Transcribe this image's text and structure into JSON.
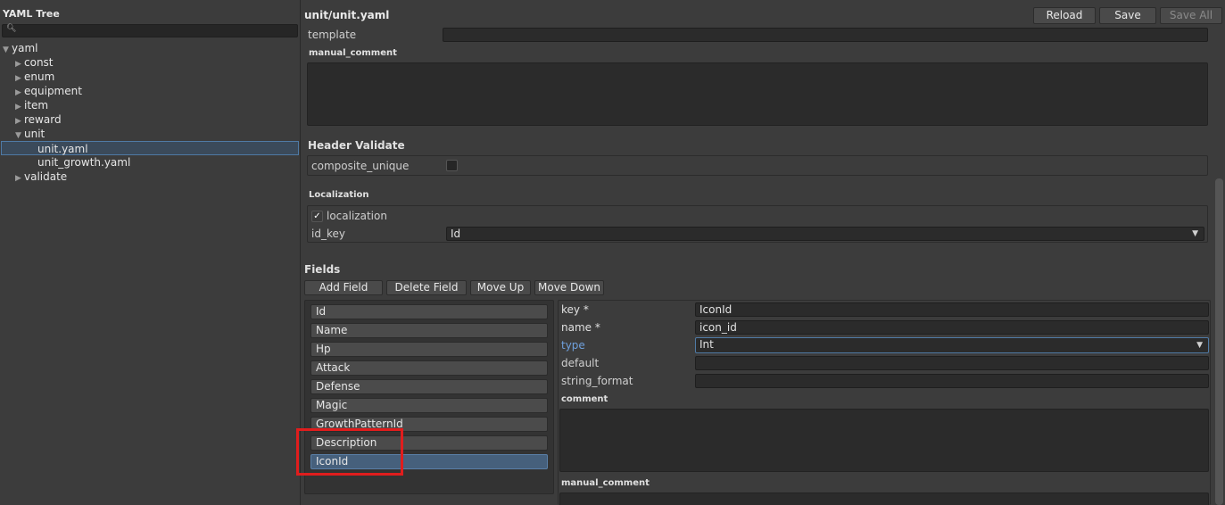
{
  "tree": {
    "title": "YAML Tree",
    "search_icon": "magnifier-icon",
    "nodes": [
      "yaml",
      "const",
      "enum",
      "equipment",
      "item",
      "reward",
      "unit",
      "unit.yaml",
      "unit_growth.yaml",
      "validate"
    ]
  },
  "header": {
    "file": "unit/unit.yaml",
    "reload": "Reload",
    "save": "Save",
    "save_all": "Save All"
  },
  "top_form": {
    "template_label": "template",
    "template_value": "",
    "manual_comment_label": "manual_comment",
    "manual_comment_value": ""
  },
  "header_validate": {
    "title": "Header Validate",
    "composite_unique_label": "composite_unique",
    "composite_unique_checked": false
  },
  "localization": {
    "title": "Localization",
    "checkbox_label": "localization",
    "checkbox_checked": true,
    "id_key_label": "id_key",
    "id_key_value": "Id"
  },
  "fields": {
    "title": "Fields",
    "add": "Add Field",
    "delete": "Delete Field",
    "up": "Move Up",
    "down": "Move Down",
    "items": [
      "Id",
      "Name",
      "Hp",
      "Attack",
      "Defense",
      "Magic",
      "GrowthPatternId",
      "Description",
      "IconId"
    ],
    "selected": "IconId"
  },
  "detail": {
    "key_label": "key *",
    "key_value": "IconId",
    "name_label": "name *",
    "name_value": "icon_id",
    "type_label": "type",
    "type_value": "Int",
    "default_label": "default",
    "default_value": "",
    "string_format_label": "string_format",
    "string_format_value": "",
    "comment_label": "comment",
    "manual_comment_label": "manual_comment"
  },
  "colors": {
    "accent": "#4f7aa5",
    "highlight_box": "#e01d1d",
    "type_label": "#6fa0dc"
  }
}
